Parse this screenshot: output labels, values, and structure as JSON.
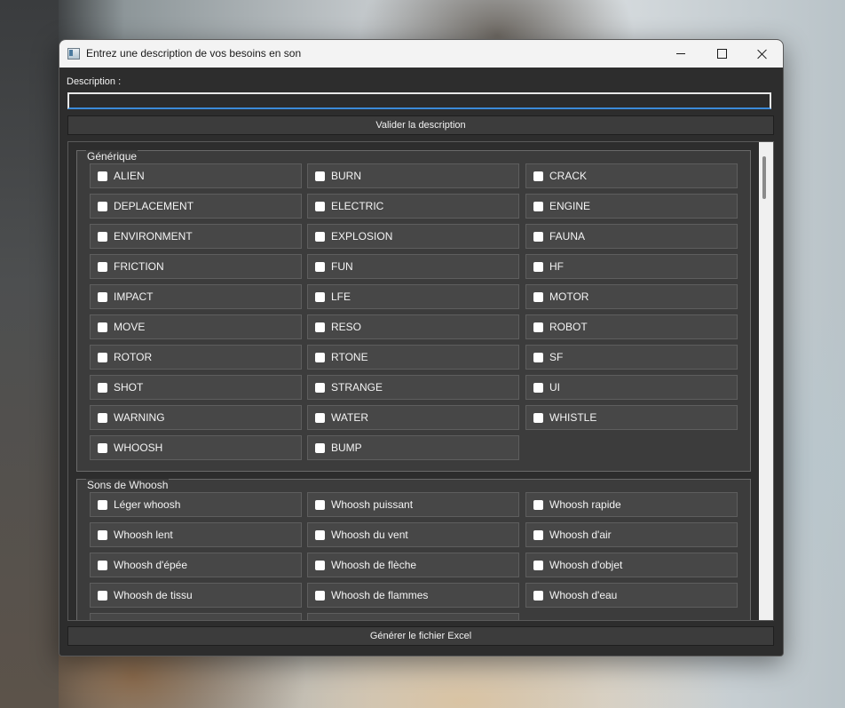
{
  "window": {
    "title": "Entrez une description de vos besoins en son"
  },
  "description": {
    "label": "Description :",
    "value": "",
    "validate_label": "Valider la description"
  },
  "groups": [
    {
      "title": "Générique",
      "items": [
        "ALIEN",
        "BURN",
        "CRACK",
        "DEPLACEMENT",
        "ELECTRIC",
        "ENGINE",
        "ENVIRONMENT",
        "EXPLOSION",
        "FAUNA",
        "FRICTION",
        "FUN",
        "HF",
        "IMPACT",
        "LFE",
        "MOTOR",
        "MOVE",
        "RESO",
        "ROBOT",
        "ROTOR",
        "RTONE",
        "SF",
        "SHOT",
        "STRANGE",
        "UI",
        "WARNING",
        "WATER",
        "WHISTLE",
        "WHOOSH",
        "BUMP"
      ]
    },
    {
      "title": "Sons de Whoosh",
      "items": [
        "Léger whoosh",
        "Whoosh puissant",
        "Whoosh rapide",
        "Whoosh lent",
        "Whoosh du vent",
        "Whoosh d'air",
        "Whoosh d'épée",
        "Whoosh de flèche",
        "Whoosh d'objet",
        "Whoosh de tissu",
        "Whoosh de flammes",
        "Whoosh d'eau",
        "",
        ""
      ]
    }
  ],
  "generate_label": "Générer le fichier Excel"
}
